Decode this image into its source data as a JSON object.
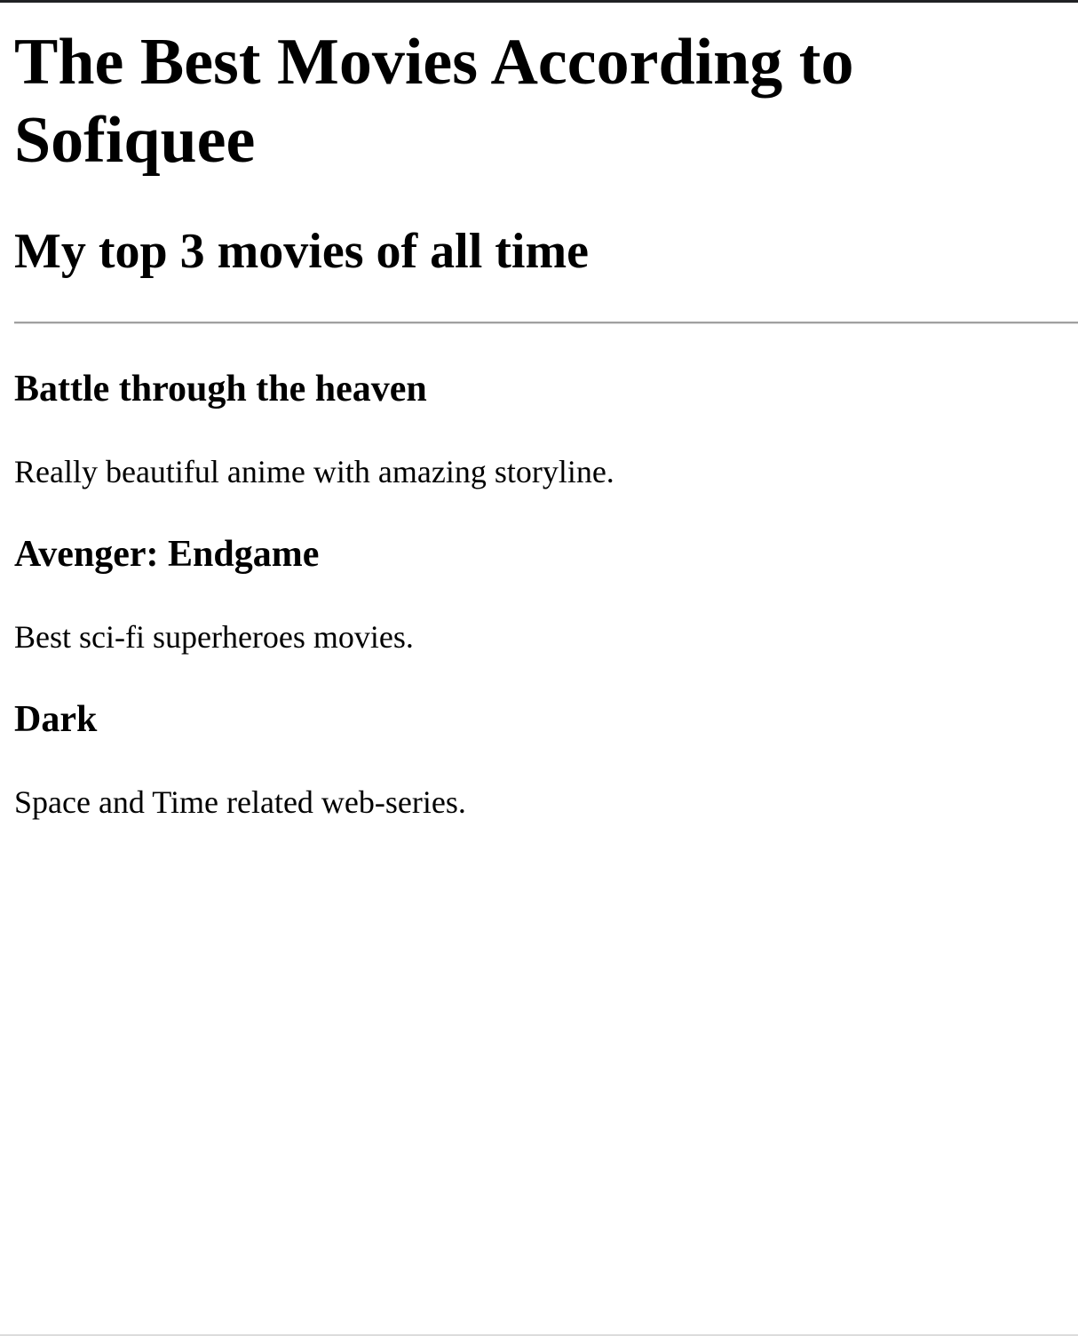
{
  "page": {
    "title": "The Best Movies According to Sofiquee",
    "subtitle": "My top 3 movies of all time"
  },
  "movies": [
    {
      "title": "Battle through the heaven",
      "description": "Really beautiful anime with amazing storyline."
    },
    {
      "title": "Avenger: Endgame",
      "description": "Best sci-fi superheroes movies."
    },
    {
      "title": "Dark",
      "description": "Space and Time related web-series."
    }
  ],
  "colors": {
    "text": "#000000",
    "background": "#ffffff",
    "divider": "#a0a0a0",
    "top_bar": "#202124"
  }
}
